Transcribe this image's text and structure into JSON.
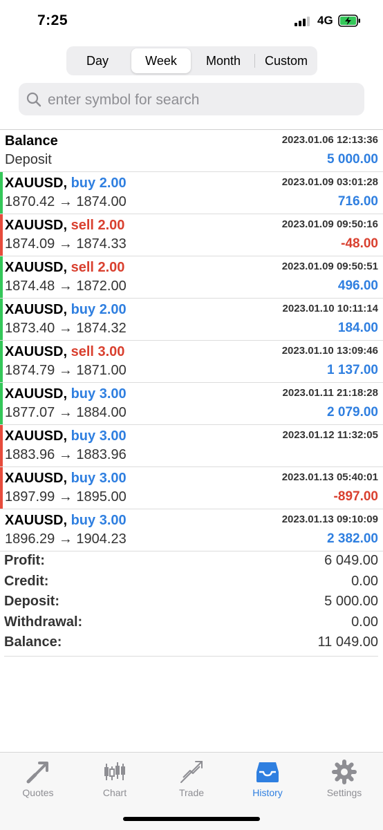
{
  "status_bar": {
    "time": "7:25",
    "network": "4G"
  },
  "segmented": {
    "items": [
      "Day",
      "Week",
      "Month",
      "Custom"
    ],
    "selected": "Week"
  },
  "search": {
    "placeholder": "enter symbol for search",
    "value": ""
  },
  "balance_entry": {
    "title": "Balance",
    "subtitle": "Deposit",
    "datetime": "2023.01.06 12:13:36",
    "amount": "5 000.00"
  },
  "trades": [
    {
      "symbol": "XAUUSD,",
      "side": "buy 2.00",
      "prices": "1870.42 → 1874.00",
      "datetime": "2023.01.09 03:01:28",
      "profit": "716.00",
      "bar": "green"
    },
    {
      "symbol": "XAUUSD,",
      "side": "sell 2.00",
      "prices": "1874.09 → 1874.33",
      "datetime": "2023.01.09 09:50:16",
      "profit": "-48.00",
      "bar": "red"
    },
    {
      "symbol": "XAUUSD,",
      "side": "sell 2.00",
      "prices": "1874.48 → 1872.00",
      "datetime": "2023.01.09 09:50:51",
      "profit": "496.00",
      "bar": "green"
    },
    {
      "symbol": "XAUUSD,",
      "side": "buy 2.00",
      "prices": "1873.40 → 1874.32",
      "datetime": "2023.01.10 10:11:14",
      "profit": "184.00",
      "bar": "green"
    },
    {
      "symbol": "XAUUSD,",
      "side": "sell 3.00",
      "prices": "1874.79 → 1871.00",
      "datetime": "2023.01.10 13:09:46",
      "profit": "1 137.00",
      "bar": "green"
    },
    {
      "symbol": "XAUUSD,",
      "side": "buy 3.00",
      "prices": "1877.07 → 1884.00",
      "datetime": "2023.01.11 21:18:28",
      "profit": "2 079.00",
      "bar": "green"
    },
    {
      "symbol": "XAUUSD,",
      "side": "buy 3.00",
      "prices": "1883.96 → 1883.96",
      "datetime": "2023.01.12 11:32:05",
      "profit": "",
      "bar": "red"
    },
    {
      "symbol": "XAUUSD,",
      "side": "buy 3.00",
      "prices": "1897.99 → 1895.00",
      "datetime": "2023.01.13 05:40:01",
      "profit": "-897.00",
      "bar": "red"
    },
    {
      "symbol": "XAUUSD,",
      "side": "buy 3.00",
      "prices": "1896.29 → 1904.23",
      "datetime": "2023.01.13 09:10:09",
      "profit": "2 382.00",
      "bar": "green"
    }
  ],
  "summary": [
    {
      "label": "Profit:",
      "value": "6 049.00"
    },
    {
      "label": "Credit:",
      "value": "0.00"
    },
    {
      "label": "Deposit:",
      "value": "5 000.00"
    },
    {
      "label": "Withdrawal:",
      "value": "0.00"
    },
    {
      "label": "Balance:",
      "value": "11 049.00"
    }
  ],
  "tabbar": [
    {
      "label": "Quotes",
      "icon": "quotes-icon"
    },
    {
      "label": "Chart",
      "icon": "chart-icon"
    },
    {
      "label": "Trade",
      "icon": "trade-icon"
    },
    {
      "label": "History",
      "icon": "history-icon",
      "active": true
    },
    {
      "label": "Settings",
      "icon": "settings-icon"
    }
  ],
  "colors": {
    "accent": "#2f7fe0",
    "loss": "#d9402f",
    "profit_bar": "#34c759",
    "loss_bar": "#e74c3c"
  }
}
